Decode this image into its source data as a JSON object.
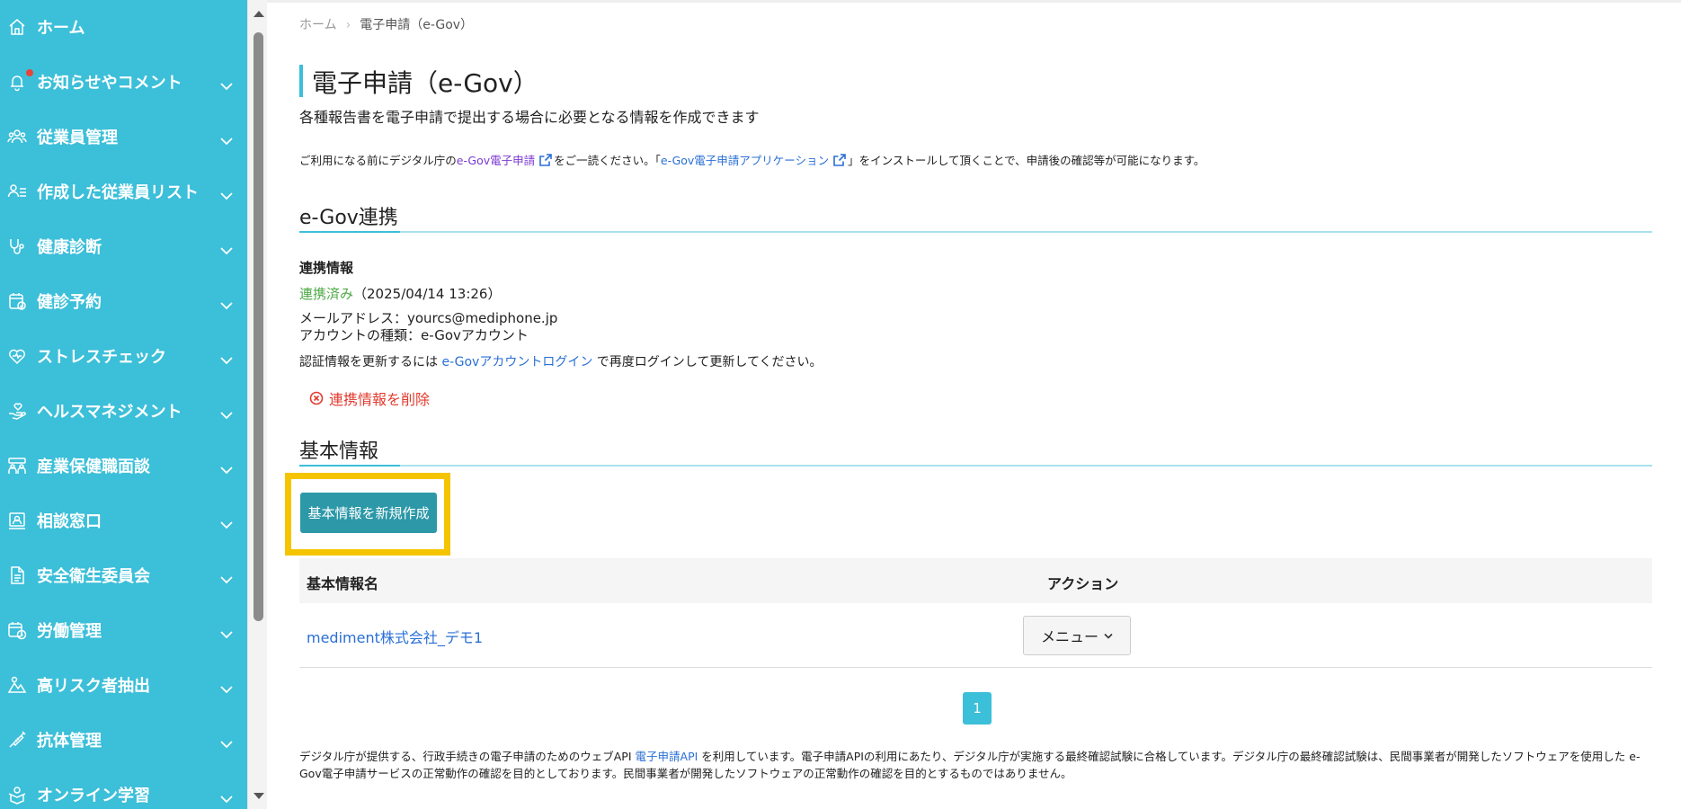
{
  "sidebar": {
    "items": [
      {
        "label": "ホーム",
        "icon": "home-icon",
        "has_chevron": false
      },
      {
        "label": "お知らせやコメント",
        "icon": "bell-icon",
        "has_chevron": true,
        "notification": true
      },
      {
        "label": "従業員管理",
        "icon": "users-icon",
        "has_chevron": true
      },
      {
        "label": "作成した従業員リスト",
        "icon": "user-list-icon",
        "has_chevron": true
      },
      {
        "label": "健康診断",
        "icon": "stethoscope-icon",
        "has_chevron": true
      },
      {
        "label": "健診予約",
        "icon": "calendar-check-icon",
        "has_chevron": true
      },
      {
        "label": "ストレスチェック",
        "icon": "heart-icon",
        "has_chevron": true
      },
      {
        "label": "ヘルスマネジメント",
        "icon": "hand-heart-icon",
        "has_chevron": true
      },
      {
        "label": "産業保健職面談",
        "icon": "meeting-icon",
        "has_chevron": true
      },
      {
        "label": "相談窓口",
        "icon": "consult-icon",
        "has_chevron": true
      },
      {
        "label": "安全衛生委員会",
        "icon": "document-icon",
        "has_chevron": true
      },
      {
        "label": "労働管理",
        "icon": "clock-calendar-icon",
        "has_chevron": true
      },
      {
        "label": "高リスク者抽出",
        "icon": "risk-chart-icon",
        "has_chevron": true
      },
      {
        "label": "抗体管理",
        "icon": "syringe-icon",
        "has_chevron": true
      },
      {
        "label": "オンライン学習",
        "icon": "learning-icon",
        "has_chevron": true
      }
    ]
  },
  "breadcrumb": {
    "home": "ホーム",
    "separator": "›",
    "current": "電子申請（e-Gov）"
  },
  "page": {
    "title": "電子申請（e-Gov）",
    "subtitle": "各種報告書を電子申請で提出する場合に必要となる情報を作成できます"
  },
  "notice": {
    "prefix": "ご利用になる前にデジタル庁の",
    "link1": "e-Gov電子申請",
    "middle": "をご一読ください。「",
    "link2": "e-Gov電子申請アプリケーション",
    "suffix": "」をインストールして頂くことで、申請後の確認等が可能になります。"
  },
  "egov_section": {
    "title": "e-Gov連携",
    "info_heading": "連携情報",
    "status": "連携済み",
    "status_date": "（2025/04/14 13:26）",
    "email_line": "メールアドレス：yourcs@mediphone.jp",
    "account_type_line": "アカウントの種類：e-Govアカウント",
    "reauth_prefix": "認証情報を更新するには ",
    "reauth_link": "e-Govアカウントログイン",
    "reauth_suffix": " で再度ログインして更新してください。",
    "delete_label": "連携情報を削除"
  },
  "basic_section": {
    "title": "基本情報",
    "create_button": "基本情報を新規作成",
    "table": {
      "headers": [
        "基本情報名",
        "アクション"
      ],
      "rows": [
        {
          "name": "mediment株式会社_デモ1",
          "action": "メニュー"
        }
      ]
    }
  },
  "pagination": {
    "current": "1"
  },
  "footer": {
    "prefix": "デジタル庁が提供する、行政手続きの電子申請のためのウェブAPI ",
    "link": "電子申請API",
    "suffix": " を利用しています。電子申請APIの利用にあたり、デジタル庁が実施する最終確認試験に合格しています。デジタル庁の最終確認試験は、民間事業者が開発したソフトウェアを使用した e-Gov電子申請サービスの正常動作の確認を目的としております。民間事業者が開発したソフトウェアの正常動作の確認を目的とするものではありません。"
  },
  "colors": {
    "sidebar": "#3cbfd9",
    "accent": "#3cbfd9",
    "button": "#2c98a8",
    "highlight": "#f5c400",
    "link": "#2a6fd6",
    "success": "#4ea946",
    "danger": "#e33a2e"
  }
}
